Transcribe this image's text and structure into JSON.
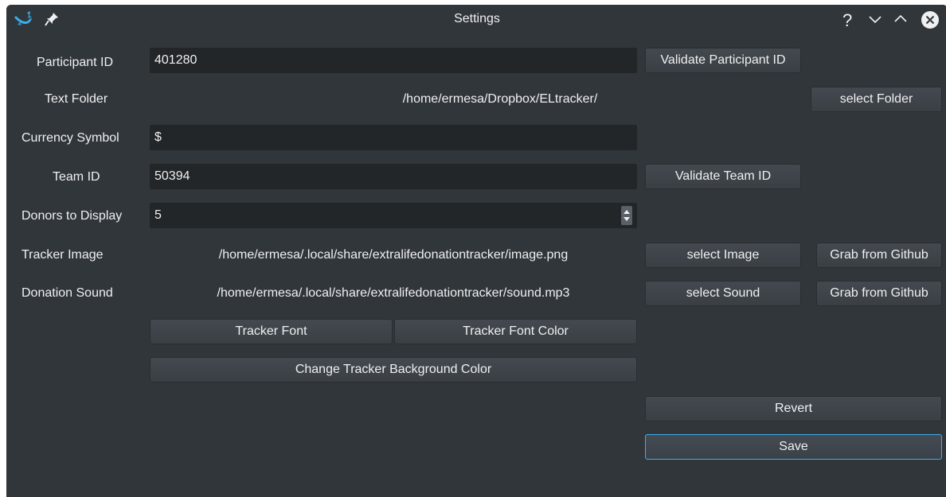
{
  "window": {
    "title": "Settings"
  },
  "titlebar": {
    "app_icon": "kde-dragon-icon",
    "pin_icon": "pin-icon",
    "help_label": "?",
    "minimize_icon": "chevron-down-icon",
    "maximize_icon": "chevron-up-icon",
    "close_icon": "close-icon"
  },
  "form": {
    "participant_id": {
      "label": "Participant ID",
      "value": "401280",
      "button": "Validate Participant ID"
    },
    "text_folder": {
      "label": "Text Folder",
      "value": "/home/ermesa/Dropbox/ELtracker/",
      "button": "select Folder"
    },
    "currency_symbol": {
      "label": "Currency Symbol",
      "value": "$"
    },
    "team_id": {
      "label": "Team ID",
      "value": "50394",
      "button": "Validate Team ID"
    },
    "donors_to_display": {
      "label": "Donors to Display",
      "value": "5"
    },
    "tracker_image": {
      "label": "Tracker Image",
      "value": "/home/ermesa/.local/share/extralifedonationtracker/image.png",
      "button": "select Image",
      "github_button": "Grab from Github"
    },
    "donation_sound": {
      "label": "Donation Sound",
      "value": "/home/ermesa/.local/share/extralifedonationtracker/sound.mp3",
      "button": "select Sound",
      "github_button": "Grab from Github"
    }
  },
  "buttons": {
    "tracker_font": "Tracker Font",
    "tracker_font_color": "Tracker Font Color",
    "change_background": "Change Tracker Background Color",
    "revert": "Revert",
    "save": "Save"
  },
  "colors": {
    "background": "#31363b",
    "field": "#232629",
    "accent": "#3daee9",
    "text": "#eff0f1"
  }
}
